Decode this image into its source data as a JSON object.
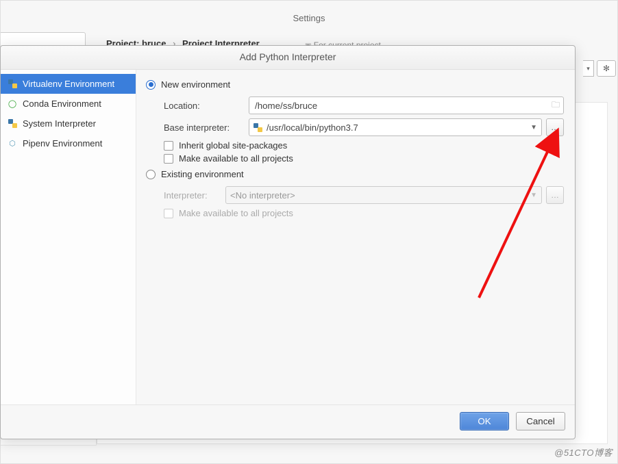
{
  "background": {
    "title": "Settings",
    "breadcrumb_project_prefix": "Project:",
    "breadcrumb_project_name": "bruce",
    "breadcrumb_page": "Project Interpreter",
    "current_hint": "For current project"
  },
  "dialog": {
    "title": "Add Python Interpreter",
    "sidebar": {
      "items": [
        {
          "id": "virtualenv",
          "label": "Virtualenv Environment",
          "icon": "venv",
          "selected": true
        },
        {
          "id": "conda",
          "label": "Conda Environment",
          "icon": "conda",
          "selected": false
        },
        {
          "id": "system",
          "label": "System Interpreter",
          "icon": "python",
          "selected": false
        },
        {
          "id": "pipenv",
          "label": "Pipenv Environment",
          "icon": "pipenv",
          "selected": false
        }
      ]
    },
    "form": {
      "new_env_radio_label": "New environment",
      "location_label": "Location:",
      "location_value": "/home/ss/bruce",
      "base_interpreter_label": "Base interpreter:",
      "base_interpreter_value": "/usr/local/bin/python3.7",
      "inherit_label": "Inherit global site-packages",
      "make_available_label": "Make available to all projects",
      "existing_env_radio_label": "Existing environment",
      "interpreter_label": "Interpreter:",
      "interpreter_value": "<No interpreter>",
      "make_available2_label": "Make available to all projects"
    },
    "footer": {
      "ok_label": "OK",
      "cancel_label": "Cancel"
    }
  },
  "watermark": "@51CTO博客"
}
